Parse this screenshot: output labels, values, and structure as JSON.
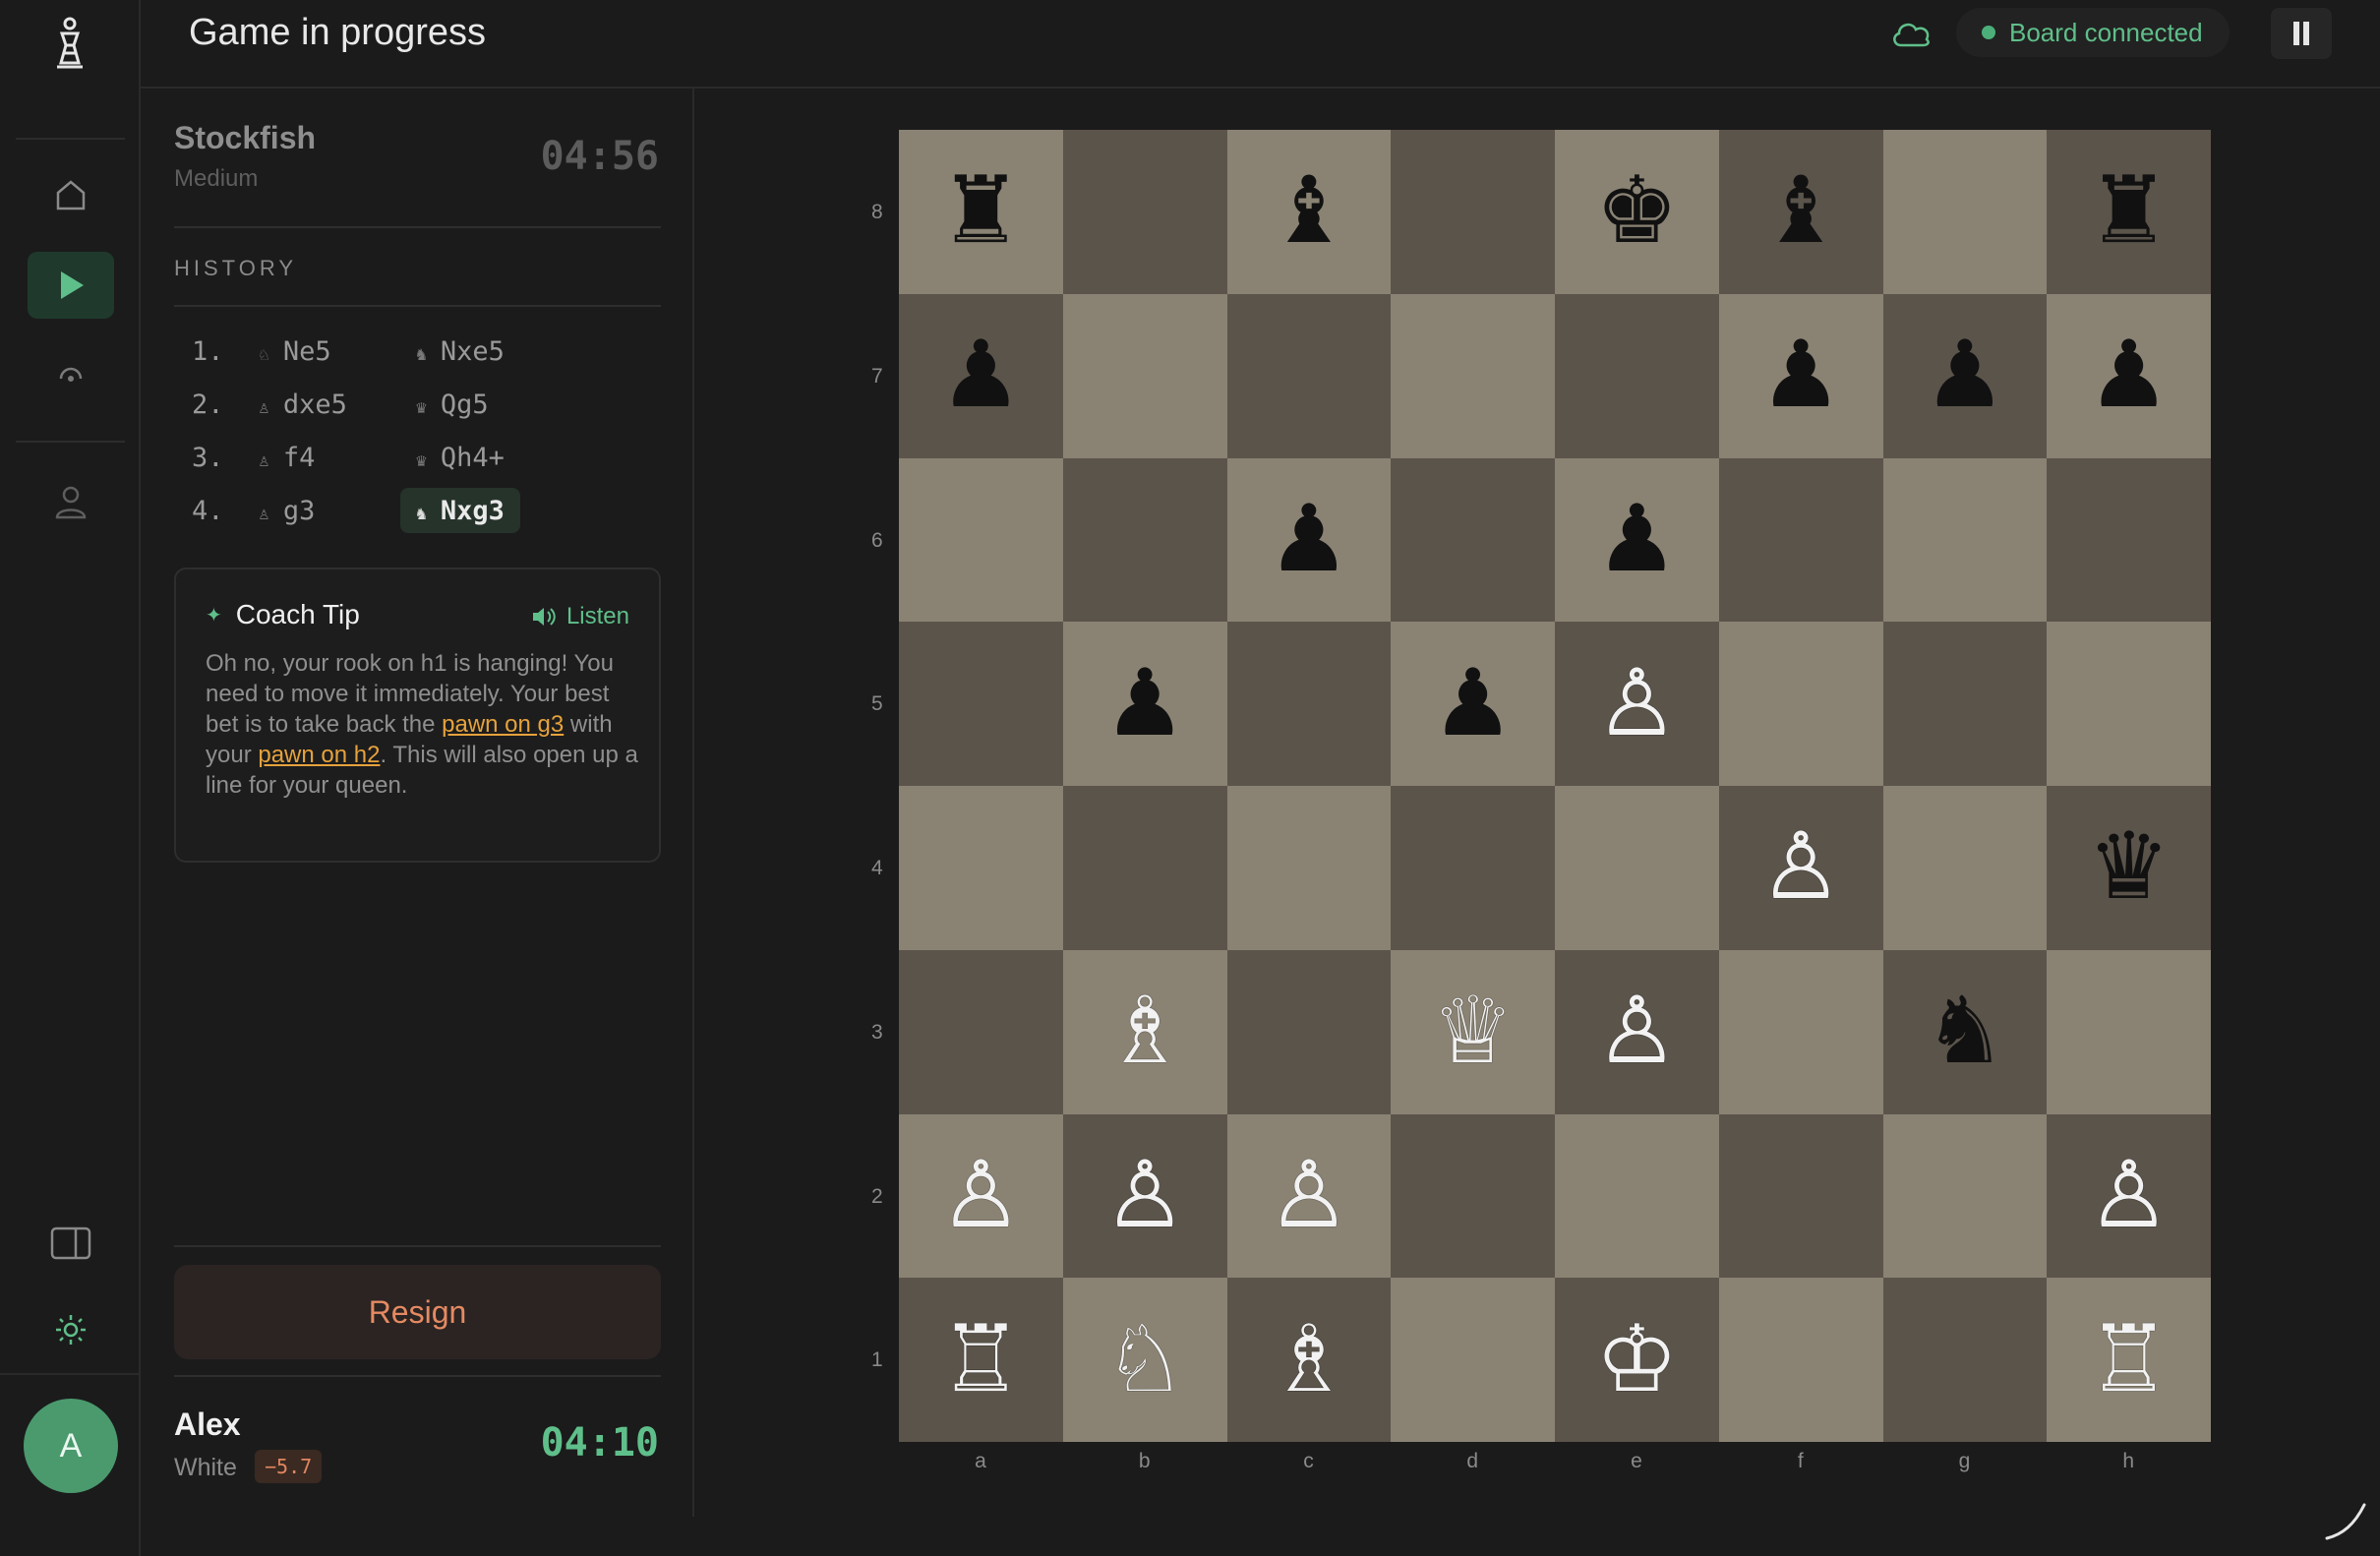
{
  "header": {
    "title": "Game in progress",
    "status": "Board connected"
  },
  "rail": {
    "avatar_initial": "A",
    "icons": [
      "chess-logo-icon",
      "home-icon",
      "play-icon",
      "broadcast-icon",
      "user-icon",
      "panel-toggle-icon",
      "sun-icon"
    ]
  },
  "opponent": {
    "name": "Stockfish",
    "level": "Medium",
    "clock": "04:56"
  },
  "history": {
    "label": "HISTORY",
    "moves": [
      {
        "num": "1.",
        "white": "Ne5",
        "white_piece": "♘",
        "black": "Nxe5",
        "black_piece": "♞"
      },
      {
        "num": "2.",
        "white": "dxe5",
        "white_piece": "♙",
        "black": "Qg5",
        "black_piece": "♛"
      },
      {
        "num": "3.",
        "white": "f4",
        "white_piece": "♙",
        "black": "Qh4+",
        "black_piece": "♛"
      },
      {
        "num": "4.",
        "white": "g3",
        "white_piece": "♙",
        "black": "Nxg3",
        "black_piece": "♞"
      }
    ]
  },
  "coach": {
    "title": "Coach Tip",
    "listen": "Listen",
    "text_1": "Oh no, your rook on h1 is hanging! You need to move it immediately. Your best bet is to take back the ",
    "link_1": "pawn on g3",
    "text_2": " with your ",
    "link_2": "pawn on h2",
    "text_3": ". This will also open up a line for your queen."
  },
  "resign_label": "Resign",
  "player": {
    "name": "Alex",
    "color": "White",
    "eval": "−5.7",
    "clock": "04:10"
  },
  "board": {
    "files": [
      "a",
      "b",
      "c",
      "d",
      "e",
      "f",
      "g",
      "h"
    ],
    "ranks": [
      "8",
      "7",
      "6",
      "5",
      "4",
      "3",
      "2",
      "1"
    ],
    "position": [
      [
        "r",
        "",
        "b",
        "",
        "k",
        "b",
        "",
        "r"
      ],
      [
        "p",
        "",
        "",
        "",
        "",
        "p",
        "p",
        "p"
      ],
      [
        "",
        "",
        "p",
        "",
        "p",
        "",
        "",
        ""
      ],
      [
        "",
        "p",
        "",
        "p",
        "P",
        "",
        "",
        ""
      ],
      [
        "",
        "",
        "",
        "",
        "",
        "P",
        "",
        "q"
      ],
      [
        "",
        "B",
        "",
        "Q",
        "P",
        "",
        "n",
        ""
      ],
      [
        "P",
        "P",
        "P",
        "",
        "",
        "",
        "",
        "P"
      ],
      [
        "R",
        "N",
        "B",
        "",
        "K",
        "",
        "",
        "R"
      ]
    ]
  },
  "colors": {
    "accent": "#5fbf8a",
    "light_square": "#8a8374",
    "dark_square": "#5b544b",
    "resign": "#e58a62",
    "highlight": "#e6a23c"
  }
}
